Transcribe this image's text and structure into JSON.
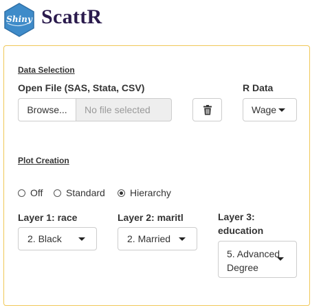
{
  "header": {
    "logo_text": "Shiny",
    "title": "ScattR"
  },
  "colors": {
    "logo_blue": "#3e8bc9",
    "title_purple": "#2b1b4d",
    "panel_border": "#f0c756"
  },
  "data_selection": {
    "section_title": "Data Selection",
    "open_file_label": "Open File (SAS, Stata, CSV)",
    "browse_label": "Browse...",
    "file_placeholder": "No file selected",
    "delete_icon": "trash-icon",
    "r_data_label": "R Data",
    "r_data_value": "Wage"
  },
  "plot_creation": {
    "section_title": "Plot Creation",
    "radio_options": [
      {
        "label": "Off",
        "selected": false
      },
      {
        "label": "Standard",
        "selected": false
      },
      {
        "label": "Hierarchy",
        "selected": true
      }
    ],
    "layers": [
      {
        "label": "Layer 1: race",
        "value": "2. Black"
      },
      {
        "label": "Layer 2: maritl",
        "value": "2. Married"
      },
      {
        "label": "Layer 3: education",
        "value": "5. Advanced Degree"
      }
    ]
  }
}
